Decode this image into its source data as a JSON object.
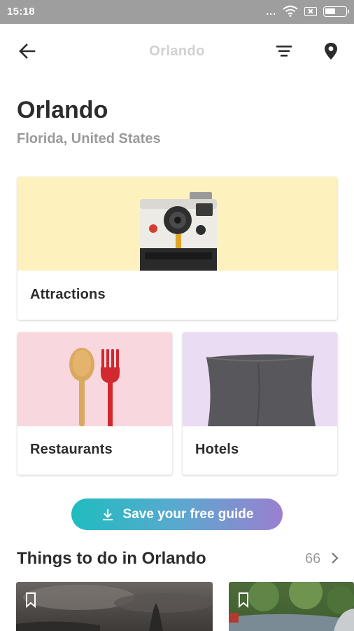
{
  "status_bar": {
    "time": "15:18",
    "dots": "..."
  },
  "app_bar": {
    "title": "Orlando"
  },
  "header": {
    "city": "Orlando",
    "subtitle": "Florida, United States"
  },
  "categories": [
    {
      "label": "Attractions"
    },
    {
      "label": "Restaurants"
    },
    {
      "label": "Hotels"
    }
  ],
  "save_button": {
    "label": "Save your free guide"
  },
  "things_to_do": {
    "title": "Things to do in Orlando",
    "count": "66"
  },
  "colors": {
    "attractions_bg": "#fdf1be",
    "restaurants_bg": "#f9d7de",
    "hotels_bg": "#eadcf3",
    "gradient_start": "#1fbcbf",
    "gradient_end": "#9b7fd0"
  }
}
